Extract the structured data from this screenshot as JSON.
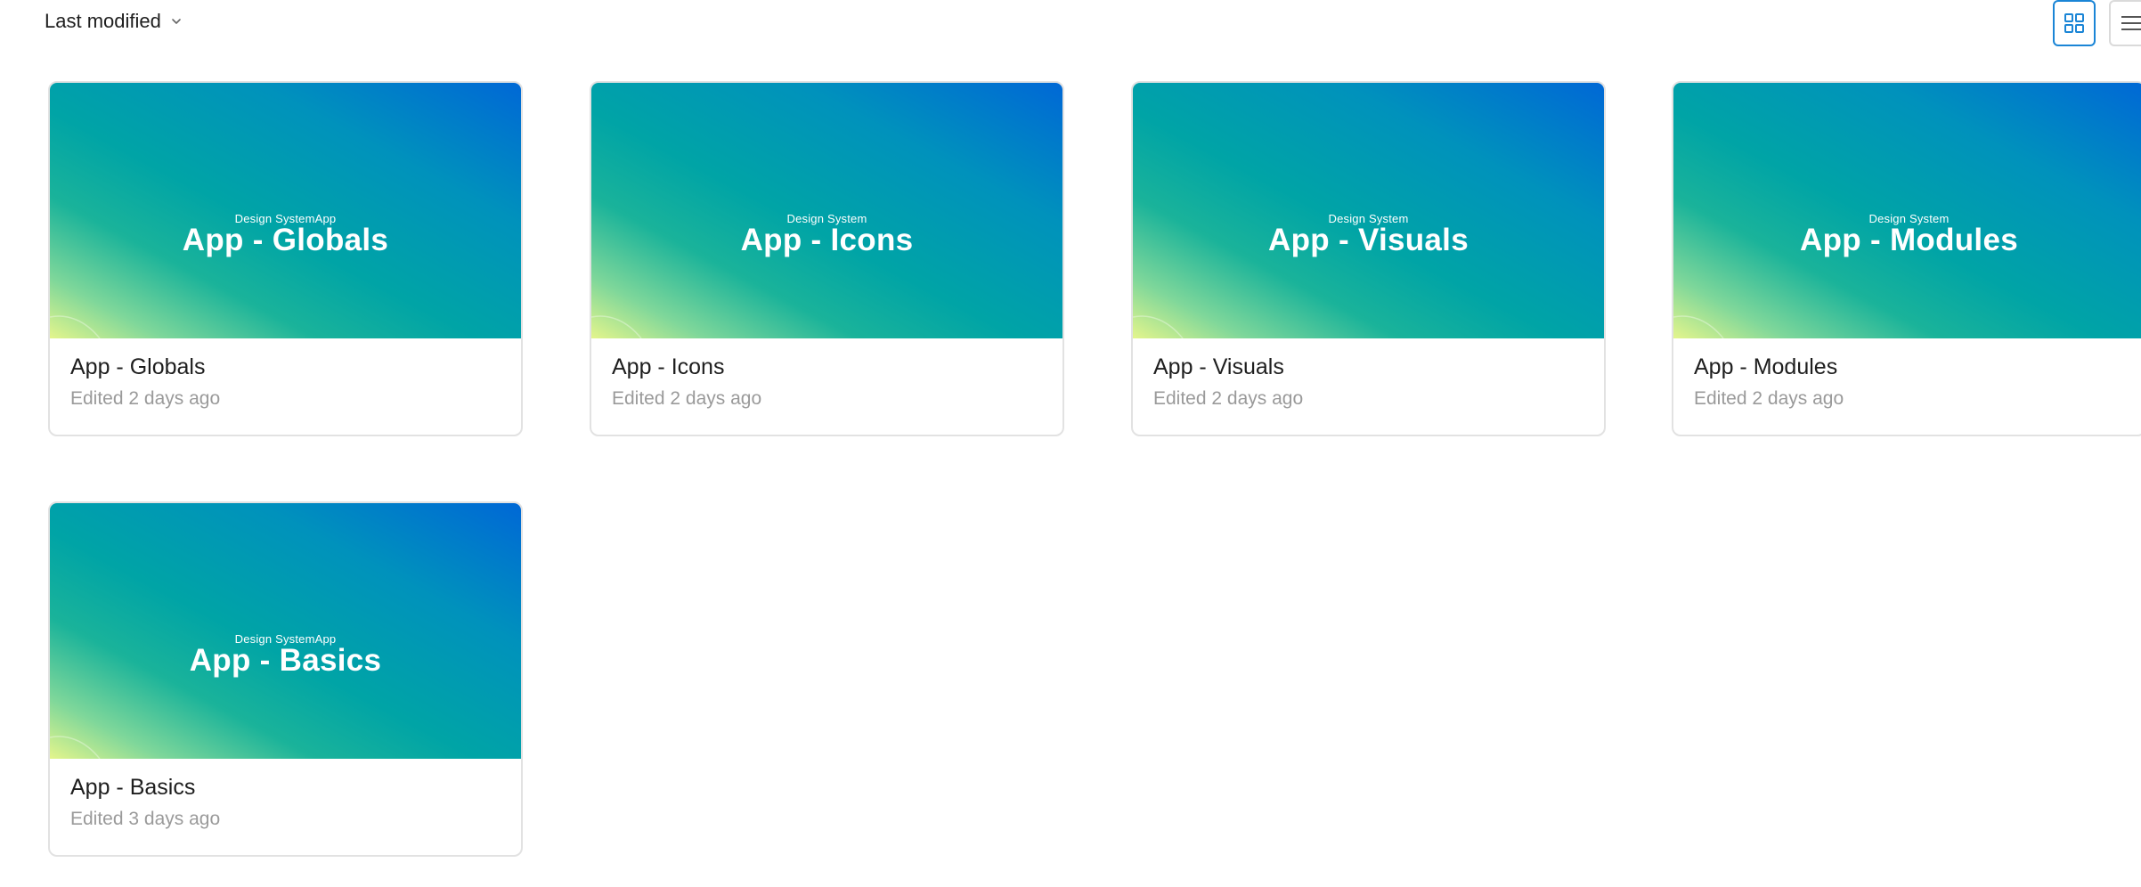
{
  "toolbar": {
    "sort_label": "Last modified",
    "sort_icon": "chevron-down-icon",
    "grid_view_icon": "grid-view-icon",
    "list_view_icon": "list-view-icon",
    "accent_color": "#1a85d6"
  },
  "files": [
    {
      "thumb_subtitle": "Design SystemApp",
      "thumb_title": "App - Globals",
      "name": "App - Globals",
      "edited": "Edited 2 days ago"
    },
    {
      "thumb_subtitle": "Design System",
      "thumb_title": "App - Icons",
      "name": "App - Icons",
      "edited": "Edited 2 days ago"
    },
    {
      "thumb_subtitle": "Design System",
      "thumb_title": "App - Visuals",
      "name": "App - Visuals",
      "edited": "Edited 2 days ago"
    },
    {
      "thumb_subtitle": "Design System",
      "thumb_title": "App - Modules",
      "name": "App - Modules",
      "edited": "Edited 2 days ago"
    },
    {
      "thumb_subtitle": "Design SystemApp",
      "thumb_title": "App - Basics",
      "name": "App - Basics",
      "edited": "Edited 3 days ago"
    }
  ]
}
